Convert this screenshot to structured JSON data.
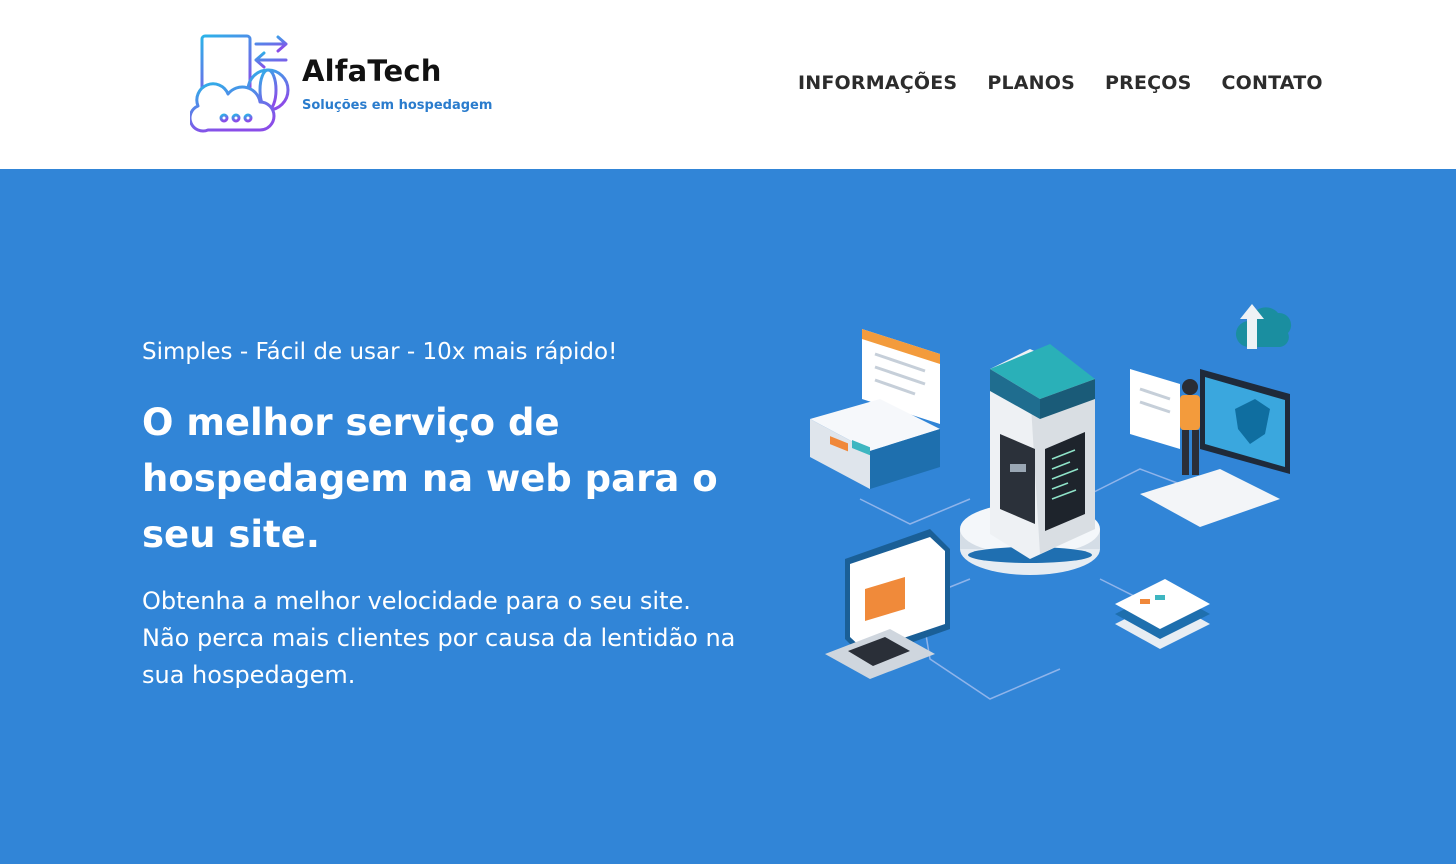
{
  "header": {
    "brand": {
      "name": "AlfaTech",
      "tagline": "Soluções em hospedagem",
      "icon": "server-cloud-logo-icon"
    },
    "nav": [
      {
        "label": "INFORMAÇÕES"
      },
      {
        "label": "PLANOS"
      },
      {
        "label": "PREÇOS"
      },
      {
        "label": "CONTATO"
      }
    ]
  },
  "hero": {
    "kicker": "Simples - Fácil de usar - 10x mais rápido!",
    "title": "O melhor serviço de hospedagem na web para o seu site.",
    "description": "Obtenha a melhor velocidade para o seu site. Não perca mais clientes por causa da lentidão na sua hospedagem.",
    "illustration": "isometric-hosting-server-illustration"
  },
  "colors": {
    "hero_bg": "#3185d7",
    "brand_tag": "#2a7ccd",
    "nav_text": "#2c2c2c",
    "logo_gradient_start": "#2bb3e8",
    "logo_gradient_end": "#8a4de8"
  }
}
